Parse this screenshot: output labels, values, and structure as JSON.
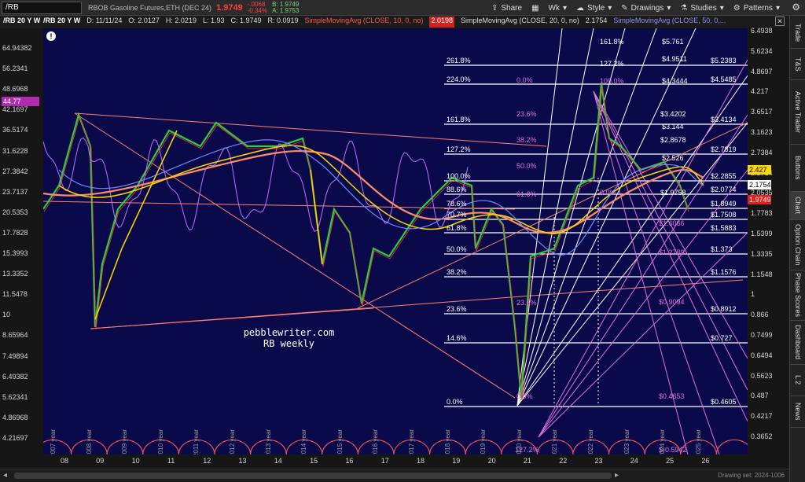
{
  "toolbar": {
    "symbol": "/RB",
    "description": "RBOB Gasoline Futures,ETH (DEC 24)",
    "last": "1.9749",
    "change": "-.0068",
    "change_pct": "-0.34%",
    "bid": "B: 1.9749",
    "ask": "A: 1.9753",
    "share": "Share",
    "wk": "Wk",
    "style": "Style",
    "drawings": "Drawings",
    "studies": "Studies",
    "patterns": "Patterns"
  },
  "chart_header": {
    "symbol": "/RB 20 Y W",
    "date": "D: 11/11/24",
    "open": "O: 2.0127",
    "high": "H: 2.0219",
    "low": "L: 1.93",
    "close": "C: 1.9749",
    "range": "R: 0.0919",
    "sma10": "SimpleMovingAvg (CLOSE, 10, 0, no)",
    "sma10_val": "2.0198",
    "sma20": "SimpleMovingAvg (CLOSE, 20, 0, no)",
    "sma20_val": "2.1754",
    "sma50": "SimpleMovingAvg (CLOSE, 50, 0,..."
  },
  "left_axis": [
    "64.94382",
    "56.2341",
    "48.6968",
    "42.1697",
    "36.5174",
    "31.6228",
    "27.3842",
    "23.7137",
    "20.5353",
    "17.7828",
    "15.3993",
    "13.3352",
    "11.5478",
    "10",
    "8.65964",
    "7.49894",
    "6.49382",
    "5.62341",
    "4.86968",
    "4.21697"
  ],
  "left_tag": "44.77",
  "right_axis": [
    "6.4938",
    "5.6234",
    "4.8697",
    "4.217",
    "3.6517",
    "3.1623",
    "2.7384",
    "2.3714",
    "2.0535",
    "1.7783",
    "1.5399",
    "1.3335",
    "1.1548",
    "1",
    "0.866",
    "0.7499",
    "0.6494",
    "0.5623",
    "0.487",
    "0.4217",
    "0.3652"
  ],
  "right_tags": {
    "t1": "2.427",
    "t2": "2.1754",
    "t3": "1.9749"
  },
  "x_axis": [
    "08",
    "09",
    "10",
    "11",
    "12",
    "13",
    "14",
    "15",
    "16",
    "17",
    "18",
    "19",
    "20",
    "21",
    "22",
    "23",
    "24",
    "25",
    "26"
  ],
  "year_labels": [
    "2007 year",
    "2008 year",
    "2009 year",
    "2010 year",
    "2011 year",
    "2012 year",
    "2013 year",
    "2014 year",
    "2015 year",
    "2016 year",
    "2017 year",
    "2018 year",
    "2019 year",
    "2020 year",
    "2021 year",
    "2022 year",
    "2023 year",
    "2024 year",
    "2025 year"
  ],
  "fib_left": [
    "261.8%",
    "224.0%",
    "161.8%",
    "127.2%",
    "100.0%",
    "88.6%",
    "78.6%",
    "70.7%",
    "61.8%",
    "50.0%",
    "38.2%",
    "23.6%",
    "14.6%",
    "0.0%"
  ],
  "fib_right": [
    "$5.2383",
    "$4.5485",
    "$3.4134",
    "$2.7819",
    "$2.2855",
    "$2.0774",
    "$1.8949",
    "$1.7508",
    "$1.5883",
    "$1.373",
    "$1.1576",
    "$0.8912",
    "$0.727",
    "$0.4605"
  ],
  "fib_top": [
    "161.8%",
    "$5.761",
    "127.2%",
    "$4.9511",
    "0.0%",
    "100.0%",
    "$4.3444",
    "23.6%",
    "$3.4202",
    "$3.144",
    "38.2%",
    "$2.8678",
    "50.0%",
    "$2.526",
    "61.8%",
    "0.0%",
    "$1.9758"
  ],
  "fib_magenta": [
    "$1.6066",
    "$1.2789",
    "$0.9094",
    "0.0%",
    "$0.4653",
    "127.2%",
    "$-0.5942",
    "23.6%"
  ],
  "watermark": {
    "line1": "pebblewriter.com",
    "line2": "RB weekly"
  },
  "side_tabs": [
    "Trade",
    "T&S",
    "Active Trader",
    "Buttons",
    "Chart",
    "Option Chain",
    "Phase Scores",
    "Dashboard",
    "L 2",
    "News"
  ],
  "footer": "Drawing set: 2024-1006",
  "colors": {
    "plot_bg": "#0a0a4a",
    "price_up": "#2ecc40",
    "price_down": "#ff3333",
    "fib": "#ffffff",
    "fib_alt": "#e070e0",
    "ma_yellow": "#ffd700",
    "ma_orange": "#ff8c66"
  }
}
